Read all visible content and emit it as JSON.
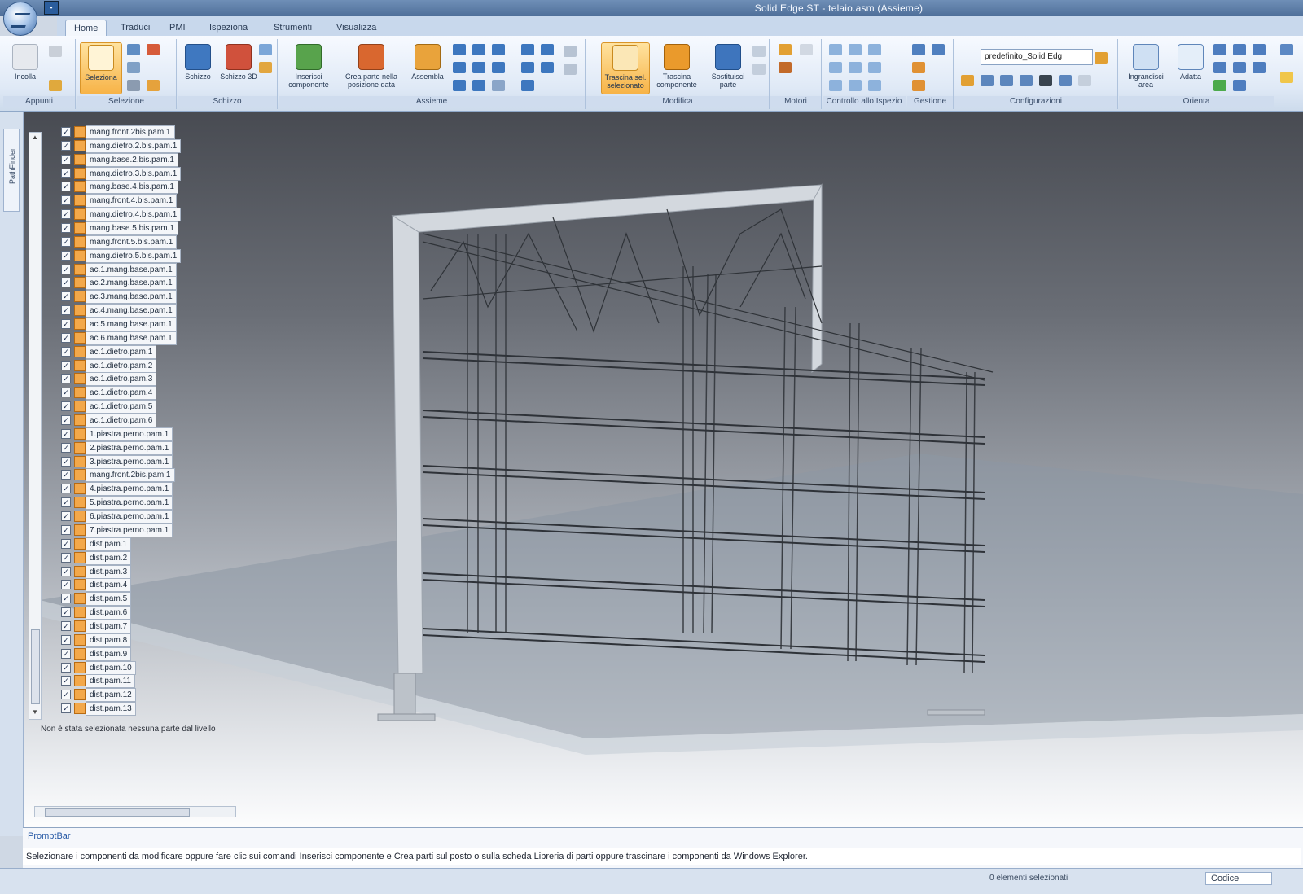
{
  "window": {
    "title": "Solid Edge ST - telaio.asm (Assieme)"
  },
  "tabs": [
    {
      "label": "Home",
      "active": true
    },
    {
      "label": "Traduci",
      "active": false
    },
    {
      "label": "PMI",
      "active": false
    },
    {
      "label": "Ispeziona",
      "active": false
    },
    {
      "label": "Strumenti",
      "active": false
    },
    {
      "label": "Visualizza",
      "active": false
    }
  ],
  "ribbon": {
    "groups": [
      {
        "label": "Appunti",
        "buttons": [
          "Incolla"
        ]
      },
      {
        "label": "Selezione",
        "buttons": [
          "Seleziona"
        ]
      },
      {
        "label": "Schizzo",
        "buttons": [
          "Schizzo",
          "Schizzo 3D"
        ]
      },
      {
        "label": "Assieme",
        "buttons": [
          "Inserisci componente",
          "Crea parte nella posizione data",
          "Assembla"
        ]
      },
      {
        "label": "Modifica",
        "buttons": [
          "Trascina sel. selezionato",
          "Trascina componente",
          "Sostituisci parte"
        ]
      },
      {
        "label": "Motori",
        "buttons": []
      },
      {
        "label": "Controllo allo Ispezio",
        "buttons": []
      },
      {
        "label": "Gestione",
        "buttons": []
      },
      {
        "label": "Configurazioni",
        "buttons": [],
        "combo_value": "predefinito_Solid Edg"
      },
      {
        "label": "Orienta",
        "buttons": [
          "Ingrandisci area",
          "Adatta"
        ]
      }
    ]
  },
  "pathfinder": {
    "side_tab_label": "PathFinder",
    "items": [
      "mang.front.2bis.pam.1",
      "mang.dietro.2.bis.pam.1",
      "mang.base.2.bis.pam.1",
      "mang.dietro.3.bis.pam.1",
      "mang.base.4.bis.pam.1",
      "mang.front.4.bis.pam.1",
      "mang.dietro.4.bis.pam.1",
      "mang.base.5.bis.pam.1",
      "mang.front.5.bis.pam.1",
      "mang.dietro.5.bis.pam.1",
      "ac.1.mang.base.pam.1",
      "ac.2.mang.base.pam.1",
      "ac.3.mang.base.pam.1",
      "ac.4.mang.base.pam.1",
      "ac.5.mang.base.pam.1",
      "ac.6.mang.base.pam.1",
      "ac.1.dietro.pam.1",
      "ac.1.dietro.pam.2",
      "ac.1.dietro.pam.3",
      "ac.1.dietro.pam.4",
      "ac.1.dietro.pam.5",
      "ac.1.dietro.pam.6",
      "1.piastra.perno.pam.1",
      "2.piastra.perno.pam.1",
      "3.piastra.perno.pam.1",
      "mang.front.2bis.pam.1",
      "4.piastra.perno.pam.1",
      "5.piastra.perno.pam.1",
      "6.piastra.perno.pam.1",
      "7.piastra.perno.pam.1",
      "dist.pam.1",
      "dist.pam.2",
      "dist.pam.3",
      "dist.pam.4",
      "dist.pam.5",
      "dist.pam.6",
      "dist.pam.7",
      "dist.pam.8",
      "dist.pam.9",
      "dist.pam.10",
      "dist.pam.11",
      "dist.pam.12",
      "dist.pam.13"
    ],
    "status": "Non è stata selezionata nessuna parte dal livello"
  },
  "prompt_bar": {
    "title": "PromptBar",
    "text": "Selezionare i componenti da modificare oppure fare clic sui comandi Inserisci componente e Crea parti sul posto o sulla scheda Libreria di parti oppure trascinare i componenti da Windows Explorer."
  },
  "status_bar": {
    "left": "0 elementi selezionati",
    "right": "Codice"
  },
  "colors": {
    "ribbon_highlight": "#f7b347",
    "viewport_top": "#484b52",
    "frame": "#c9ced6"
  }
}
